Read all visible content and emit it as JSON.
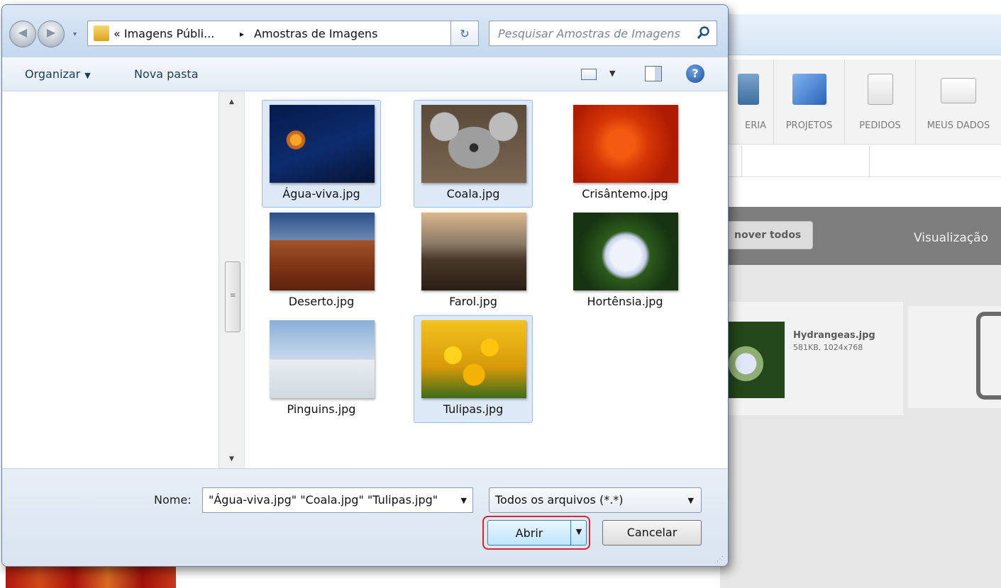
{
  "background": {
    "nav": [
      "ERIA",
      "PROJETOS",
      "PEDIDOS",
      "MEUS DADOS"
    ],
    "remove_all": "nover todos",
    "visualization": "Visualização",
    "file_name": "Hydrangeas.jpg",
    "file_meta": "581KB, 1024x768"
  },
  "dialog": {
    "breadcrumb": [
      "« Imagens Públi...",
      "▸",
      "Amostras de Imagens"
    ],
    "search_placeholder": "Pesquisar Amostras de Imagens",
    "toolbar": {
      "organize": "Organizar",
      "new_folder": "Nova pasta"
    },
    "files": [
      {
        "name": "Água-viva.jpg",
        "selected": true
      },
      {
        "name": "Coala.jpg",
        "selected": true
      },
      {
        "name": "Crisântemo.jpg",
        "selected": false
      },
      {
        "name": "Deserto.jpg",
        "selected": false
      },
      {
        "name": "Farol.jpg",
        "selected": false
      },
      {
        "name": "Hortênsia.jpg",
        "selected": false
      },
      {
        "name": "Pinguins.jpg",
        "selected": false
      },
      {
        "name": "Tulipas.jpg",
        "selected": true
      }
    ],
    "filename_label": "Nome:",
    "filename_value": "\"Água-viva.jpg\" \"Coala.jpg\" \"Tulipas.jpg\"",
    "filetype_value": "Todos os arquivos (*.*)",
    "open_label": "Abrir",
    "cancel_label": "Cancelar"
  }
}
